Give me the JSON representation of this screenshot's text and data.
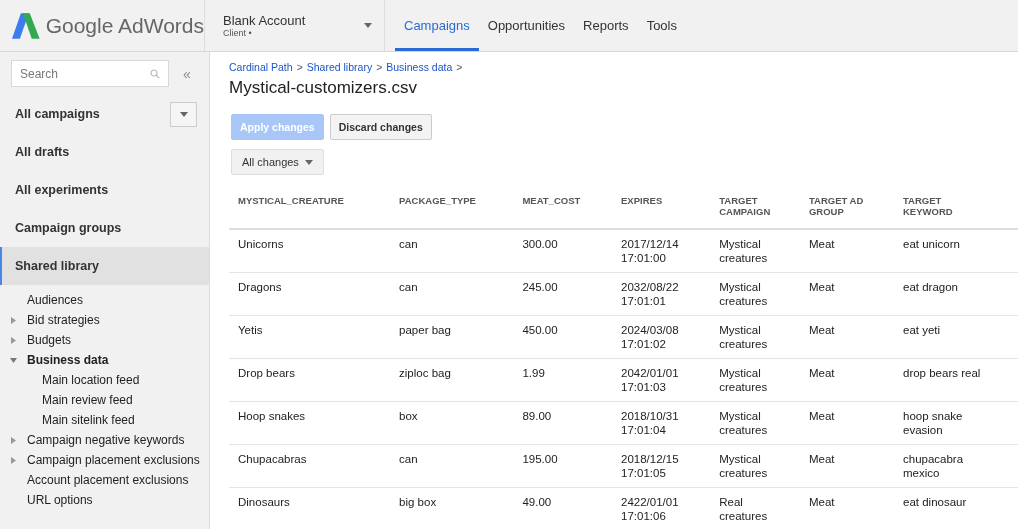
{
  "header": {
    "logo_text": "Google AdWords",
    "account": {
      "name": "Blank Account",
      "role": "Client •"
    },
    "tabs": [
      {
        "label": "Campaigns",
        "selected": true
      },
      {
        "label": "Opportunities",
        "selected": false
      },
      {
        "label": "Reports",
        "selected": false
      },
      {
        "label": "Tools",
        "selected": false
      }
    ]
  },
  "sidebar": {
    "search": {
      "placeholder": "Search"
    },
    "collapse": "«",
    "items": [
      {
        "label": "All campaigns",
        "selected": false,
        "dropdown": true
      },
      {
        "label": "All drafts",
        "selected": false
      },
      {
        "label": "All experiments",
        "selected": false
      },
      {
        "label": "Campaign groups",
        "selected": false
      },
      {
        "label": "Shared library",
        "selected": true
      }
    ],
    "library": [
      {
        "label": "Audiences",
        "kind": "leaf"
      },
      {
        "label": "Bid strategies",
        "kind": "group",
        "expanded": false
      },
      {
        "label": "Budgets",
        "kind": "group",
        "expanded": false
      },
      {
        "label": "Business data",
        "kind": "group",
        "expanded": true,
        "children": [
          {
            "label": "Main location feed"
          },
          {
            "label": "Main review feed"
          },
          {
            "label": "Main sitelink feed"
          }
        ]
      },
      {
        "label": "Campaign negative keywords",
        "kind": "group",
        "expanded": false
      },
      {
        "label": "Campaign placement exclusions",
        "kind": "group",
        "expanded": false
      },
      {
        "label": "Account placement exclusions",
        "kind": "leaf"
      },
      {
        "label": "URL options",
        "kind": "leaf"
      }
    ]
  },
  "breadcrumb": {
    "items": [
      "Cardinal Path",
      "Shared library",
      "Business data"
    ],
    "separator": ">"
  },
  "title": "Mystical-customizers.csv",
  "buttons": [
    {
      "label": "Apply changes",
      "kind": "primary",
      "disabled": true
    },
    {
      "label": "Discard changes",
      "kind": "secondary",
      "disabled": false
    }
  ],
  "filter": "All changes",
  "table": {
    "columns": [
      "MYSTICAL_CREATURE",
      "PACKAGE_TYPE",
      "MEAT_COST",
      "EXPIRES",
      "TARGET\nCAMPAIGN",
      "TARGET AD\nGROUP",
      "TARGET\nKEYWORD"
    ],
    "rows": [
      [
        "Unicorns",
        "can",
        "300.00",
        "2017/12/14\n17:01:00",
        "Mystical\ncreatures",
        "Meat",
        "eat unicorn"
      ],
      [
        "Dragons",
        "can",
        "245.00",
        "2032/08/22\n17:01:01",
        "Mystical\ncreatures",
        "Meat",
        "eat dragon"
      ],
      [
        "Yetis",
        "paper bag",
        "450.00",
        "2024/03/08\n17:01:02",
        "Mystical\ncreatures",
        "Meat",
        "eat yeti"
      ],
      [
        "Drop bears",
        "ziploc bag",
        "1.99",
        "2042/01/01\n17:01:03",
        "Mystical\ncreatures",
        "Meat",
        "drop bears real"
      ],
      [
        "Hoop snakes",
        "box",
        "89.00",
        "2018/10/31\n17:01:04",
        "Mystical\ncreatures",
        "Meat",
        "hoop snake\nevasion"
      ],
      [
        "Chupacabras",
        "can",
        "195.00",
        "2018/12/15\n17:01:05",
        "Mystical\ncreatures",
        "Meat",
        "chupacabra\nmexico"
      ],
      [
        "Dinosaurs",
        "big box",
        "49.00",
        "2422/01/01\n17:01:06",
        "Real\ncreatures",
        "Meat",
        "eat dinosaur"
      ]
    ]
  }
}
